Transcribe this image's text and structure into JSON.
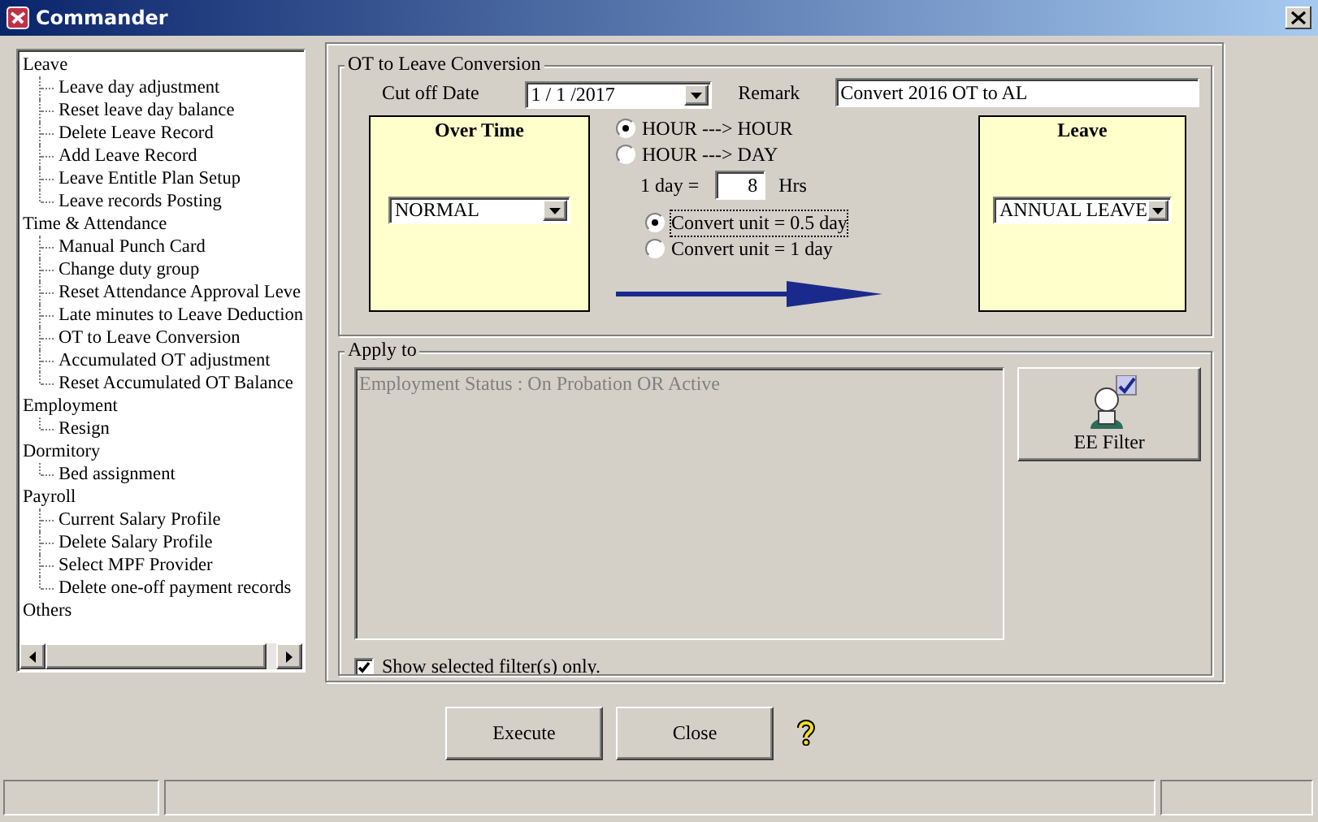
{
  "window": {
    "title": "Commander"
  },
  "tree": [
    {
      "label": "Leave",
      "children": [
        {
          "label": "Leave day adjustment"
        },
        {
          "label": "Reset leave day balance"
        },
        {
          "label": "Delete Leave Record"
        },
        {
          "label": "Add Leave Record"
        },
        {
          "label": "Leave Entitle Plan Setup"
        },
        {
          "label": "Leave records Posting"
        }
      ]
    },
    {
      "label": "Time & Attendance",
      "children": [
        {
          "label": "Manual Punch Card"
        },
        {
          "label": "Change duty group"
        },
        {
          "label": "Reset Attendance Approval Leve"
        },
        {
          "label": "Late minutes to Leave Deduction"
        },
        {
          "label": "OT to Leave Conversion"
        },
        {
          "label": "Accumulated OT adjustment"
        },
        {
          "label": "Reset Accumulated OT Balance"
        }
      ]
    },
    {
      "label": "Employment",
      "children": [
        {
          "label": "Resign"
        }
      ]
    },
    {
      "label": "Dormitory",
      "children": [
        {
          "label": "Bed assignment"
        }
      ]
    },
    {
      "label": "Payroll",
      "children": [
        {
          "label": "Current Salary Profile"
        },
        {
          "label": "Delete Salary Profile"
        },
        {
          "label": "Select MPF Provider"
        },
        {
          "label": "Delete one-off payment records"
        }
      ]
    },
    {
      "label": "Others"
    }
  ],
  "conversion": {
    "title": "OT to Leave Conversion",
    "cutoff_label": "Cut off Date",
    "cutoff_date": "1 / 1 /2017",
    "remark_label": "Remark",
    "remark": "Convert 2016 OT to AL",
    "overtime": {
      "title": "Over Time",
      "value": "NORMAL"
    },
    "modes": [
      {
        "label": "HOUR ---> HOUR",
        "selected": true
      },
      {
        "label": "HOUR ---> DAY",
        "selected": false
      }
    ],
    "day_label": "1 day =",
    "hours": "8",
    "hours_unit": "Hrs",
    "units": [
      {
        "label": "Convert unit = 0.5 day",
        "selected": true
      },
      {
        "label": "Convert unit = 1 day",
        "selected": false
      }
    ],
    "leave": {
      "title": "Leave",
      "value": "ANNUAL LEAVE"
    }
  },
  "apply": {
    "title": "Apply to",
    "filters": [
      "Employment Status : On Probation OR Active"
    ],
    "filter_button": "EE Filter",
    "show_selected_only": {
      "label": "Show selected filter(s) only.",
      "checked": true
    }
  },
  "buttons": [
    "Execute",
    "Close"
  ]
}
